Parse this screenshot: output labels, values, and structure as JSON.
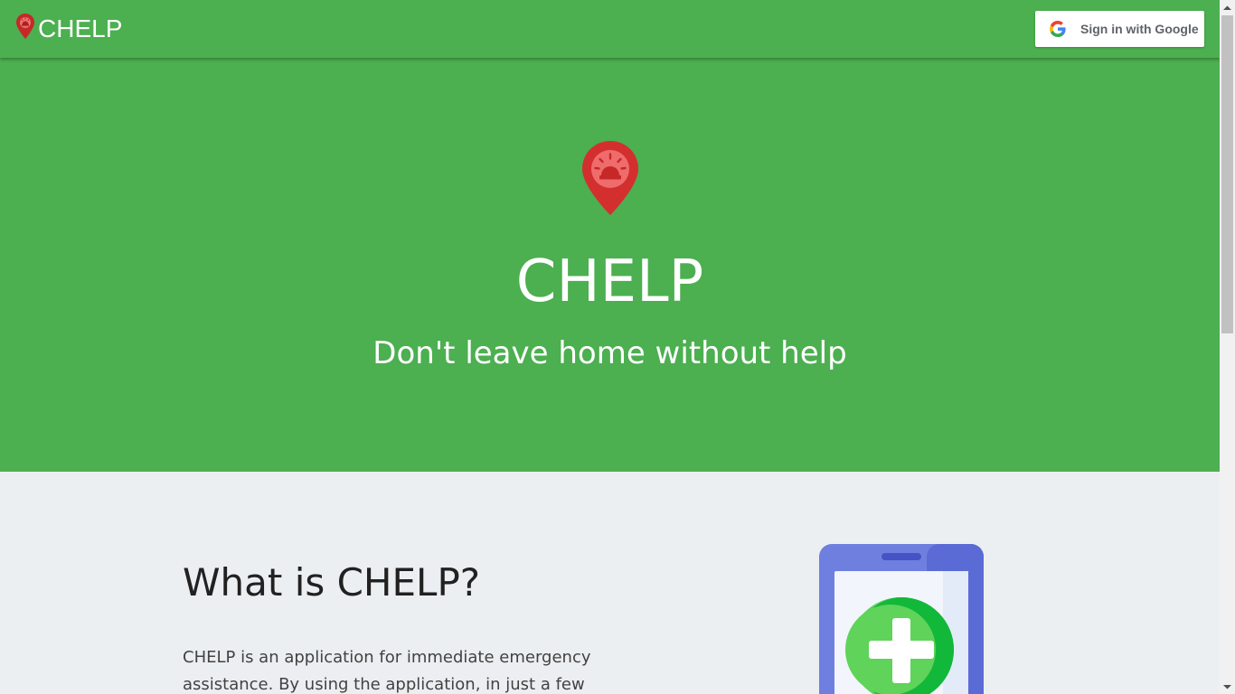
{
  "header": {
    "brand": "CHELP",
    "signin_label": "Sign in with Google"
  },
  "hero": {
    "title": "CHELP",
    "subtitle": "Don't leave home without help"
  },
  "about": {
    "title": "What is CHELP?",
    "text": "CHELP is an application for immediate emergency assistance. By using the application, in just a few taps, the"
  },
  "colors": {
    "primary_green": "#4caf50",
    "pin_red": "#d32f2f",
    "background": "#eceff1",
    "phone_blue": "#6f7fe0",
    "plus_green": "#5fd35a"
  },
  "icons": {
    "brand": "location-pin-siren-icon",
    "signin": "google-g-icon",
    "hero": "location-pin-siren-icon",
    "illustration": "phone-medical-plus-icon"
  }
}
